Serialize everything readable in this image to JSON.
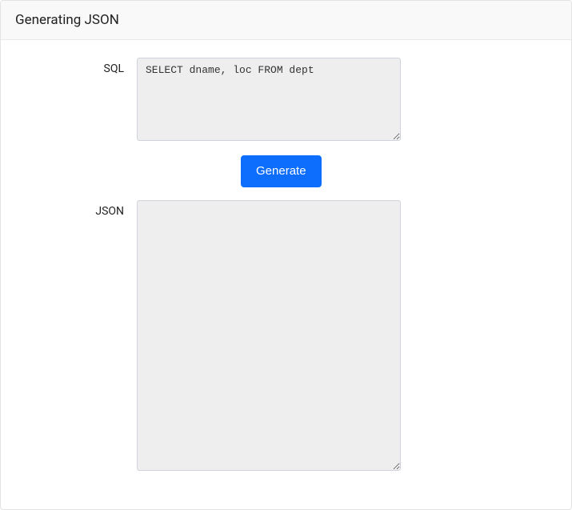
{
  "header": {
    "title": "Generating JSON"
  },
  "form": {
    "sql_label": "SQL",
    "sql_value": "SELECT dname, loc FROM dept",
    "generate_button_label": "Generate",
    "json_label": "JSON",
    "json_value": ""
  }
}
